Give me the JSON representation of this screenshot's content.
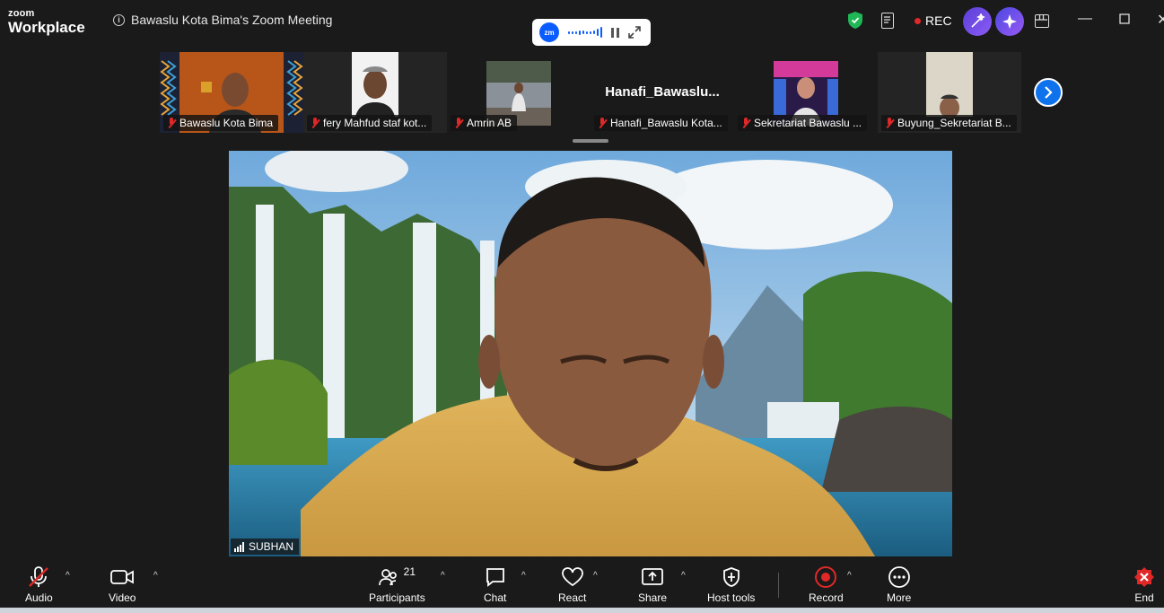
{
  "app": {
    "brand_small": "zoom",
    "brand_large": "Workplace",
    "meeting_title": "Bawaslu Kota Bima's Zoom Meeting",
    "zm_badge": "zm",
    "rec_label": "REC",
    "accent": "#0e72ed",
    "rec_color": "#e02828"
  },
  "thumbnails": [
    {
      "name": "Bawaslu Kota Bima",
      "show_video": true
    },
    {
      "name": "fery Mahfud staf kot...",
      "show_video": true
    },
    {
      "name": "Amrin AB",
      "show_video": true
    },
    {
      "name": "Hanafi_Bawaslu Kota...",
      "big_name": "Hanafi_Bawaslu...",
      "show_video": false
    },
    {
      "name": "Sekretariat Bawaslu ...",
      "show_video": true
    },
    {
      "name": "Buyung_Sekretariat B...",
      "show_video": true
    }
  ],
  "main_speaker": {
    "name": "SUBHAN"
  },
  "toolbar": {
    "audio": "Audio",
    "video": "Video",
    "participants": "Participants",
    "participants_count": "21",
    "chat": "Chat",
    "react": "React",
    "share": "Share",
    "host_tools": "Host tools",
    "record": "Record",
    "more": "More",
    "end": "End"
  }
}
